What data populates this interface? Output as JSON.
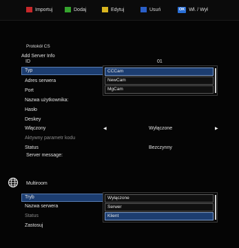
{
  "keybar": {
    "keys": [
      {
        "label": "Importuj",
        "color": "#c8282a"
      },
      {
        "label": "Dodaj",
        "color": "#35a42e"
      },
      {
        "label": "Edytuj",
        "color": "#d9b51f"
      },
      {
        "label": "Usuń",
        "color": "#2a5fc8"
      },
      {
        "label": "Wł. / Wył",
        "badge": "OK",
        "color": "#2a6fd6"
      }
    ]
  },
  "cs": {
    "section_title": "Protokół CS",
    "subtitle": "Add Server Info",
    "id_label": "ID",
    "id_value": "01",
    "rows": {
      "typ": "Typ",
      "adres": "Adres serwera",
      "port": "Port",
      "user": "Nazwa użytkownika:",
      "haslo": "Hasło",
      "deskey": "Deskey",
      "wlaczony": "Włączony",
      "wlaczony_value": "Wyłączone",
      "aktywny": "Aktywny parametr kodu",
      "status": "Status",
      "status_value": "Bezczynny",
      "message": "Server message:"
    },
    "typ_options": [
      "CCCam",
      "NewCam",
      "MgCam"
    ],
    "typ_selected": "CCCam"
  },
  "multiroom": {
    "title": "Multiroom",
    "rows": {
      "tryb": "Tryb",
      "nazwa": "Nazwa serwera",
      "status": "Status",
      "zastosuj": "Zastosuj"
    },
    "tryb_options": [
      "Wyłączone",
      "Serwer",
      "Klient"
    ],
    "tryb_selected": "Klient"
  }
}
